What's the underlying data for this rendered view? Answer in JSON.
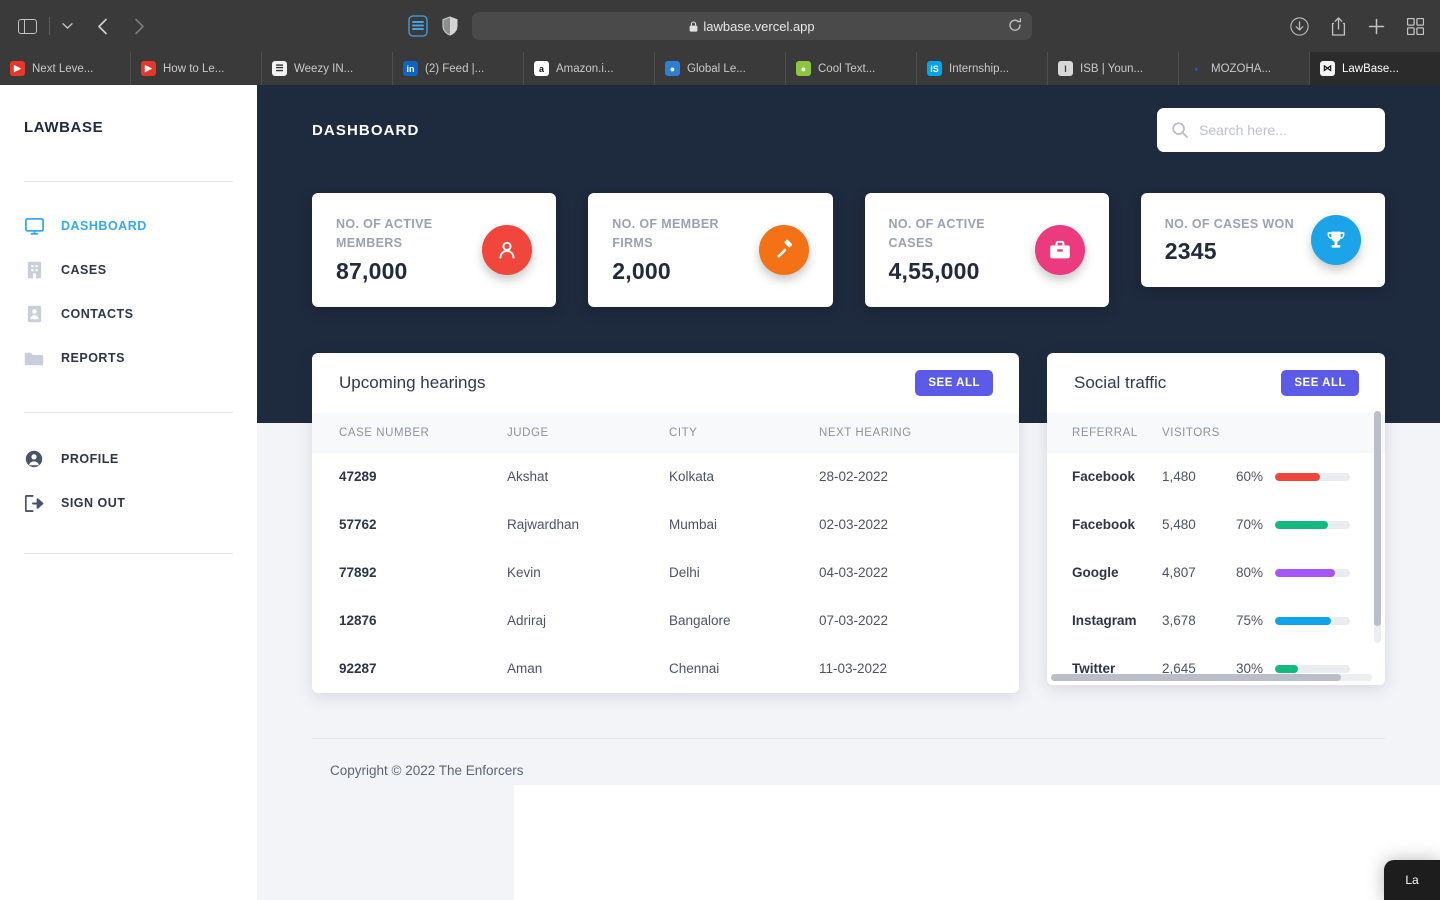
{
  "browser": {
    "url": "lawbase.vercel.app",
    "lock_icon": "lock-icon",
    "toolbar_icons": [
      "sidebar-toggle-icon",
      "chevron-down-icon",
      "back-arrow-icon",
      "forward-arrow-icon",
      "reading-list-icon",
      "shield-icon",
      "reload-icon",
      "downloads-icon",
      "share-icon",
      "new-tab-icon",
      "tab-overview-icon"
    ],
    "tabs": [
      {
        "label": "Next Leve...",
        "favicon": "youtube-icon",
        "fav_bg": "#e8362b",
        "fav_fg": "#ffffff",
        "fav_glyph": "▶",
        "active": false
      },
      {
        "label": "How to Le...",
        "favicon": "youtube-icon",
        "fav_bg": "#e8362b",
        "fav_fg": "#ffffff",
        "fav_glyph": "▶",
        "active": false
      },
      {
        "label": "Weezy IN...",
        "favicon": "news-icon",
        "fav_bg": "#f2f2f2",
        "fav_fg": "#333333",
        "fav_glyph": "☰",
        "active": false
      },
      {
        "label": "(2) Feed |...",
        "favicon": "linkedin-icon",
        "fav_bg": "#0a66c2",
        "fav_fg": "#ffffff",
        "fav_glyph": "in",
        "active": false
      },
      {
        "label": "Amazon.i...",
        "favicon": "amazon-icon",
        "fav_bg": "#ffffff",
        "fav_fg": "#111111",
        "fav_glyph": "a",
        "active": false
      },
      {
        "label": "Global Le...",
        "favicon": "globe-icon",
        "fav_bg": "#2e7fd4",
        "fav_fg": "#ffffff",
        "fav_glyph": "●",
        "active": false
      },
      {
        "label": "Cool Text...",
        "favicon": "leaf-icon",
        "fav_bg": "#8cc63f",
        "fav_fg": "#ffffff",
        "fav_glyph": "●",
        "active": false
      },
      {
        "label": "Internship...",
        "favicon": "internshala-icon",
        "fav_bg": "#00a5ec",
        "fav_fg": "#ffffff",
        "fav_glyph": "IS",
        "active": false
      },
      {
        "label": "ISB | Youn...",
        "favicon": "isb-icon",
        "fav_bg": "#d8d8d8",
        "fav_fg": "#444444",
        "fav_glyph": "I",
        "active": false
      },
      {
        "label": "MOZOHA...",
        "favicon": "mozoha-icon",
        "fav_bg": "#3a3a3a",
        "fav_fg": "#2255ee",
        "fav_glyph": "◗",
        "active": false
      },
      {
        "label": "LawBase...",
        "favicon": "lawbase-icon",
        "fav_bg": "#f5f5f5",
        "fav_fg": "#111111",
        "fav_glyph": "⋈",
        "active": true
      }
    ]
  },
  "sidebar": {
    "brand": "LAWBASE",
    "items": [
      {
        "label": "DASHBOARD",
        "icon": "monitor-icon",
        "active": true
      },
      {
        "label": "CASES",
        "icon": "briefcase-icon",
        "active": false
      },
      {
        "label": "CONTACTS",
        "icon": "contact-card-icon",
        "active": false
      },
      {
        "label": "REPORTS",
        "icon": "folder-icon",
        "active": false
      }
    ],
    "account_items": [
      {
        "label": "PROFILE",
        "icon": "user-circle-icon"
      },
      {
        "label": "SIGN OUT",
        "icon": "sign-out-icon"
      }
    ],
    "active_color": "#34a9f2"
  },
  "header": {
    "title": "DASHBOARD",
    "search": {
      "placeholder": "Search here...",
      "value": "",
      "icon": "search-icon"
    }
  },
  "stats": [
    {
      "label": "NO. OF ACTIVE MEMBERS",
      "value": "87,000",
      "icon": "user-icon",
      "color": "#f0463c",
      "two_line": true
    },
    {
      "label": "NO. OF MEMBER FIRMS",
      "value": "2,000",
      "icon": "gavel-icon",
      "color": "#f47216",
      "two_line": true
    },
    {
      "label": "NO. OF ACTIVE CASES",
      "value": "4,55,000",
      "icon": "briefcase-icon",
      "color": "#ec3a7e",
      "two_line": true
    },
    {
      "label": "NO. OF CASES WON",
      "value": "2345",
      "icon": "trophy-icon",
      "color": "#1ba4e8",
      "two_line": false
    }
  ],
  "hearings": {
    "title": "Upcoming hearings",
    "see_all_label": "SEE ALL",
    "columns": [
      "CASE NUMBER",
      "JUDGE",
      "CITY",
      "NEXT HEARING"
    ],
    "rows": [
      {
        "case_number": "47289",
        "judge": "Akshat",
        "city": "Kolkata",
        "next_hearing": "28-02-2022"
      },
      {
        "case_number": "57762",
        "judge": "Rajwardhan",
        "city": "Mumbai",
        "next_hearing": "02-03-2022"
      },
      {
        "case_number": "77892",
        "judge": "Kevin",
        "city": "Delhi",
        "next_hearing": "04-03-2022"
      },
      {
        "case_number": "12876",
        "judge": "Adriraj",
        "city": "Bangalore",
        "next_hearing": "07-03-2022"
      },
      {
        "case_number": "92287",
        "judge": "Aman",
        "city": "Chennai",
        "next_hearing": "11-03-2022"
      }
    ]
  },
  "social": {
    "title": "Social traffic",
    "see_all_label": "SEE ALL",
    "columns": [
      "REFERRAL",
      "VISITORS",
      ""
    ],
    "rows": [
      {
        "referral": "Facebook",
        "visitors": "1,480",
        "percent": "60%",
        "pct_value": 60,
        "bar_color": "#f0453b"
      },
      {
        "referral": "Facebook",
        "visitors": "5,480",
        "percent": "70%",
        "pct_value": 70,
        "bar_color": "#12b981"
      },
      {
        "referral": "Google",
        "visitors": "4,807",
        "percent": "80%",
        "pct_value": 80,
        "bar_color": "#a855f7"
      },
      {
        "referral": "Instagram",
        "visitors": "3,678",
        "percent": "75%",
        "pct_value": 75,
        "bar_color": "#0fa3e8"
      },
      {
        "referral": "Twitter",
        "visitors": "2,645",
        "percent": "30%",
        "pct_value": 30,
        "bar_color": "#12b981"
      }
    ]
  },
  "footer": {
    "text": "Copyright © 2022 The Enforcers"
  },
  "chat_widget": {
    "label": "La"
  },
  "theme": {
    "hero_bg": "#1e2a3d",
    "page_bg": "#f2f4f8",
    "accent": "#5b5be8"
  }
}
